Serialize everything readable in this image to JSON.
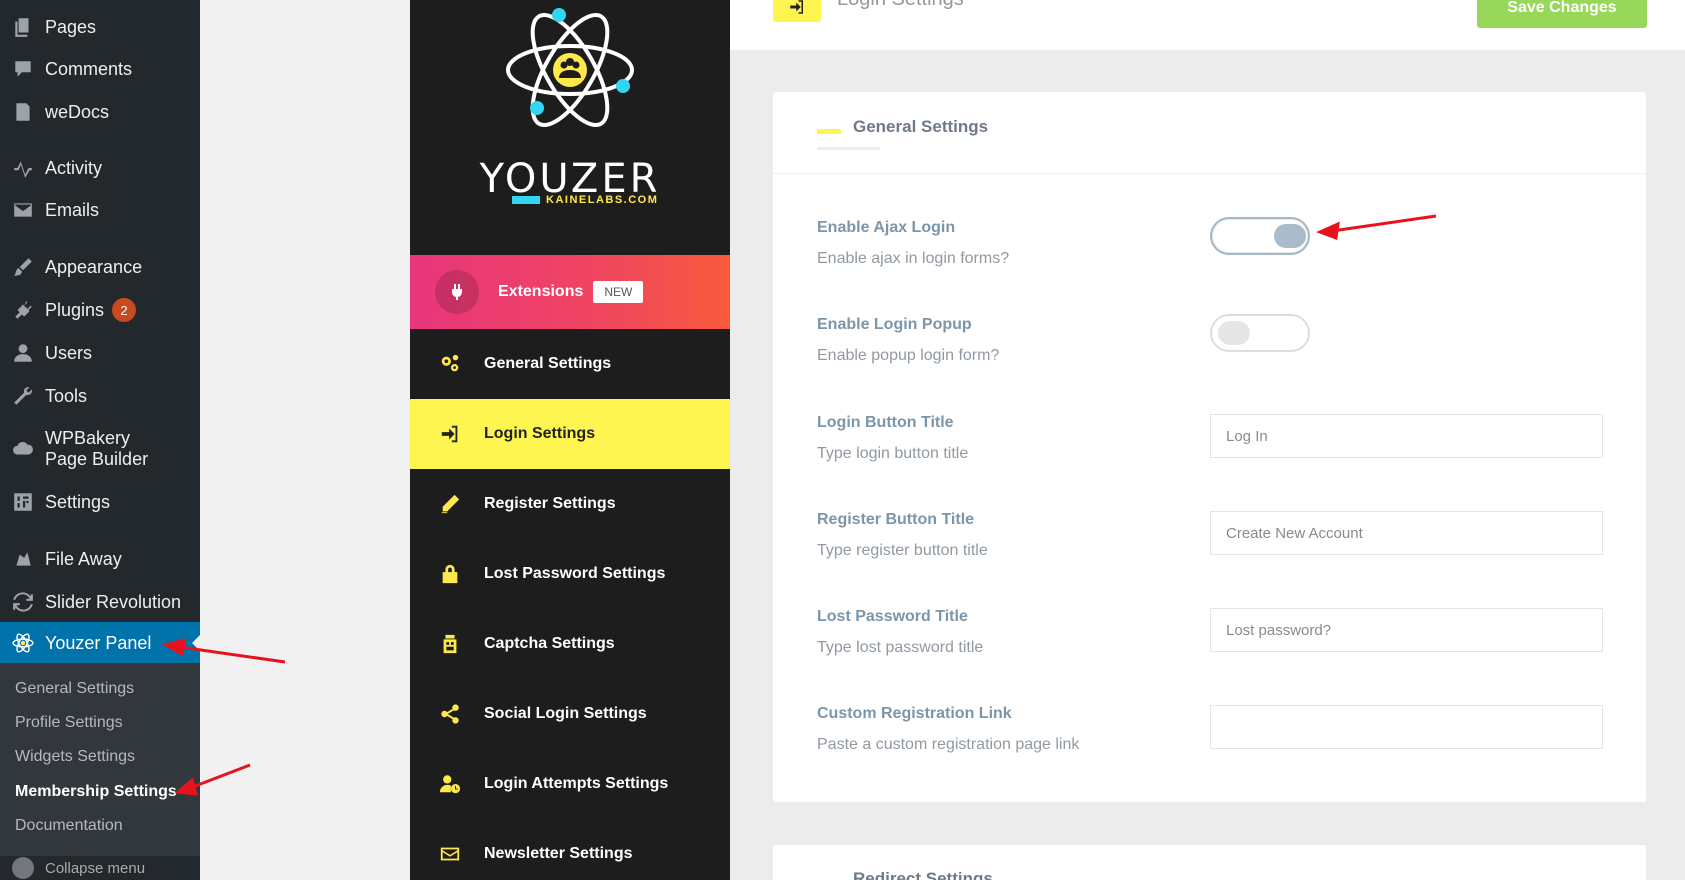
{
  "wp_menu": {
    "items": [
      {
        "label": "Pages",
        "icon": "pages-icon"
      },
      {
        "label": "Comments",
        "icon": "comments-icon"
      },
      {
        "label": "weDocs",
        "icon": "docs-icon"
      },
      {
        "label": "Activity",
        "icon": "activity-icon"
      },
      {
        "label": "Emails",
        "icon": "email-icon"
      },
      {
        "label": "Appearance",
        "icon": "brush-icon"
      },
      {
        "label": "Plugins",
        "icon": "plugin-icon",
        "badge": "2"
      },
      {
        "label": "Users",
        "icon": "user-icon"
      },
      {
        "label": "Tools",
        "icon": "wrench-icon"
      },
      {
        "label": "WPBakery Page Builder",
        "icon": "cloud-icon"
      },
      {
        "label": "Settings",
        "icon": "settings-icon"
      },
      {
        "label": "File Away",
        "icon": "file-away-icon"
      },
      {
        "label": "Slider Revolution",
        "icon": "refresh-icon"
      },
      {
        "label": "Youzer Panel",
        "icon": "atom-icon"
      }
    ],
    "submenu": [
      "General Settings",
      "Profile Settings",
      "Widgets Settings",
      "Membership Settings",
      "Documentation"
    ],
    "collapse": "Collapse menu"
  },
  "youzer": {
    "brand": "YOUZER",
    "brand_sub": "KAINELABS.COM",
    "extensions": {
      "label": "Extensions",
      "badge": "NEW"
    },
    "menu": [
      {
        "label": "General Settings",
        "icon": "gears-icon"
      },
      {
        "label": "Login Settings",
        "icon": "sign-in-icon"
      },
      {
        "label": "Register Settings",
        "icon": "pencil-icon"
      },
      {
        "label": "Lost Password Settings",
        "icon": "lock-icon"
      },
      {
        "label": "Captcha Settings",
        "icon": "captcha-icon"
      },
      {
        "label": "Social Login Settings",
        "icon": "share-icon"
      },
      {
        "label": "Login Attempts Settings",
        "icon": "user-clock-icon"
      },
      {
        "label": "Newsletter Settings",
        "icon": "envelope-icon"
      }
    ]
  },
  "header": {
    "title": "Login Settings",
    "save_label": "Save Changes"
  },
  "general": {
    "title": "General Settings",
    "options": [
      {
        "label": "Enable Ajax Login",
        "desc": "Enable ajax in login forms?",
        "type": "toggle",
        "on": true
      },
      {
        "label": "Enable Login Popup",
        "desc": "Enable popup login form?",
        "type": "toggle",
        "on": false
      },
      {
        "label": "Login Button Title",
        "desc": "Type login button title",
        "type": "text",
        "value": "Log In"
      },
      {
        "label": "Register Button Title",
        "desc": "Type register button title",
        "type": "text",
        "value": "Create New Account"
      },
      {
        "label": "Lost Password Title",
        "desc": "Type lost password title",
        "type": "text",
        "value": "Lost password?"
      },
      {
        "label": "Custom Registration Link",
        "desc": "Paste a custom registration page link",
        "type": "text",
        "value": ""
      }
    ]
  },
  "redirect": {
    "title": "Redirect Settings"
  },
  "colors": {
    "accent": "#fff551",
    "wp_active": "#0073aa",
    "save": "#97d85a",
    "arrow": "#e8121f"
  }
}
